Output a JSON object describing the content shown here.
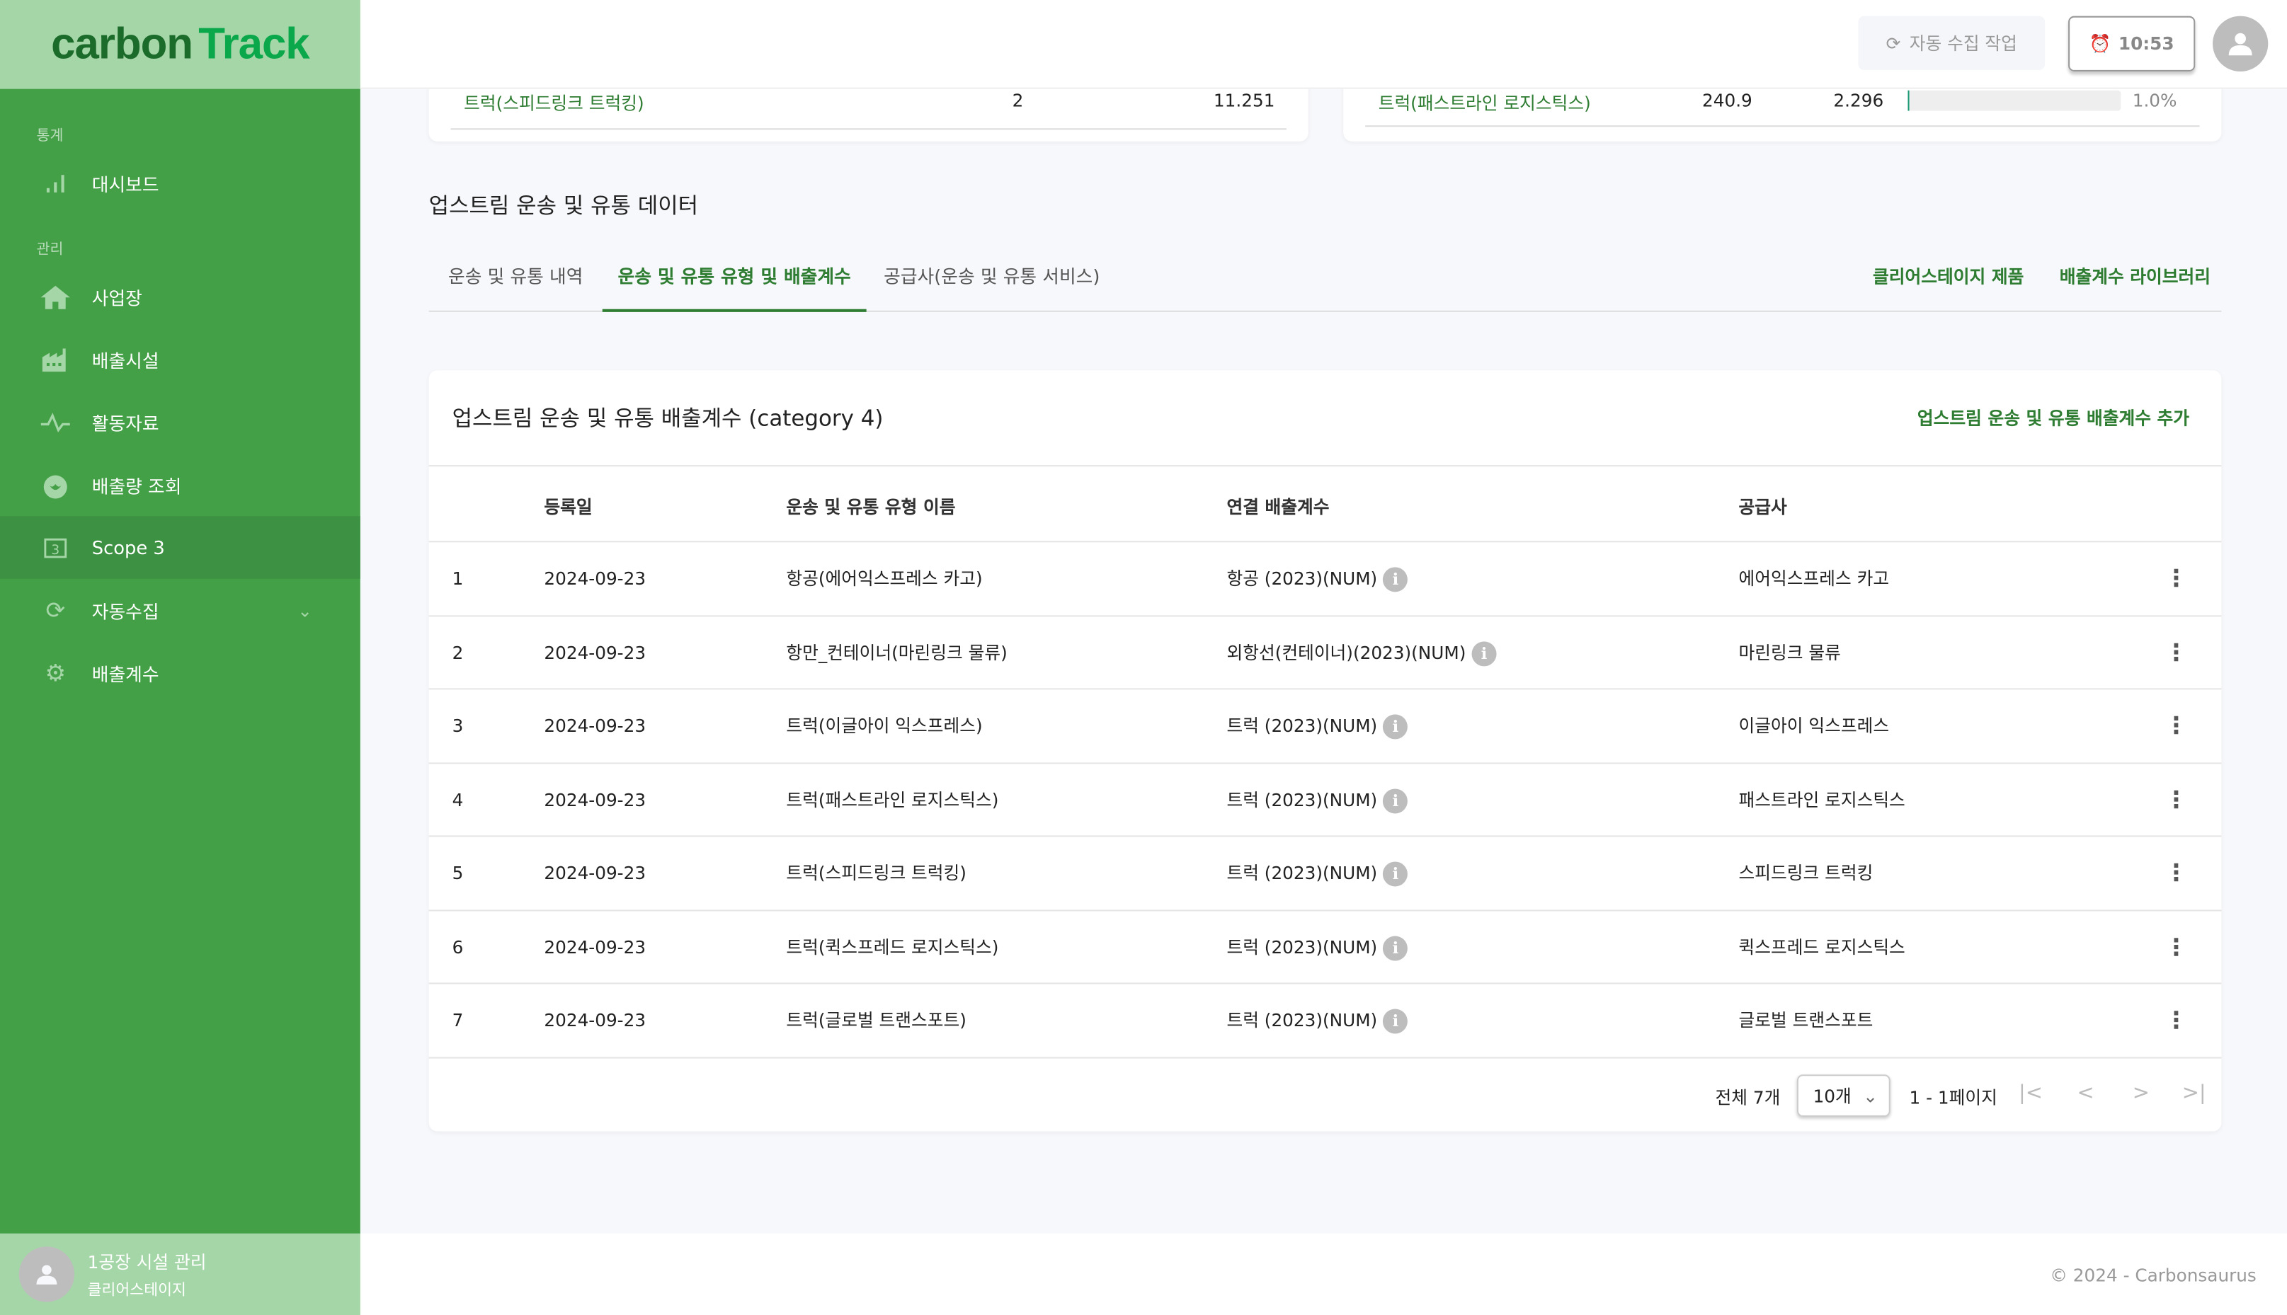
{
  "brand": {
    "part1": "carbon",
    "part2": "Track"
  },
  "sidebar": {
    "sections": [
      {
        "label": "통계"
      },
      {
        "label": "관리"
      }
    ],
    "items": [
      {
        "label": "대시보드",
        "icon": "bar-chart-icon"
      },
      {
        "label": "사업장",
        "icon": "home-icon"
      },
      {
        "label": "배출시설",
        "icon": "factory-icon"
      },
      {
        "label": "활동자료",
        "icon": "activity-icon"
      },
      {
        "label": "배출량 조회",
        "icon": "fire-icon"
      },
      {
        "label": "Scope 3",
        "icon": "scope3-icon",
        "active": true
      },
      {
        "label": "자동수집",
        "icon": "sync-icon",
        "expandable": true
      },
      {
        "label": "배출계수",
        "icon": "gear-icon"
      }
    ],
    "user": {
      "name": "1공장 시설 관리",
      "org": "클리어스테이지"
    }
  },
  "topbar": {
    "auto_collect_label": "자동 수집 작업",
    "time": "10:53"
  },
  "prev_cards": {
    "left": {
      "name": "트럭(스피드링크 트럭킹)",
      "count": "2",
      "value": "11.251"
    },
    "right": {
      "name": "트럭(패스트라인 로지스틱스)",
      "v1": "240.9",
      "v2": "2.296",
      "percent_label": "1.0%",
      "percent": 1.0
    }
  },
  "section_title": "업스트림 운송 및 유통 데이터",
  "tabs": [
    {
      "label": "운송 및 유통 내역"
    },
    {
      "label": "운송 및 유통 유형 및 배출계수",
      "active": true
    },
    {
      "label": "공급사(운송 및 유통 서비스)"
    }
  ],
  "links": {
    "clearstage_products": "클리어스테이지 제품",
    "factor_library": "배출계수 라이브러리"
  },
  "table_card": {
    "title": "업스트림 운송 및 유통 배출계수 (category 4)",
    "add_label": "업스트림 운송 및 유통 배출계수 추가",
    "columns": [
      "등록일",
      "운송 및 유통 유형 이름",
      "연결 배출계수",
      "공급사"
    ],
    "rows": [
      {
        "no": "1",
        "date": "2024-09-23",
        "name": "항공(에어익스프레스 카고)",
        "factor": "항공 (2023)(NUM)",
        "supplier": "에어익스프레스 카고"
      },
      {
        "no": "2",
        "date": "2024-09-23",
        "name": "항만_컨테이너(마린링크 물류)",
        "factor": "외항선(컨테이너)(2023)(NUM)",
        "supplier": "마린링크 물류"
      },
      {
        "no": "3",
        "date": "2024-09-23",
        "name": "트럭(이글아이 익스프레스)",
        "factor": "트럭 (2023)(NUM)",
        "supplier": "이글아이 익스프레스"
      },
      {
        "no": "4",
        "date": "2024-09-23",
        "name": "트럭(패스트라인 로지스틱스)",
        "factor": "트럭 (2023)(NUM)",
        "supplier": "패스트라인 로지스틱스"
      },
      {
        "no": "5",
        "date": "2024-09-23",
        "name": "트럭(스피드링크 트럭킹)",
        "factor": "트럭 (2023)(NUM)",
        "supplier": "스피드링크 트럭킹"
      },
      {
        "no": "6",
        "date": "2024-09-23",
        "name": "트럭(퀵스프레드 로지스틱스)",
        "factor": "트럭 (2023)(NUM)",
        "supplier": "퀵스프레드 로지스틱스"
      },
      {
        "no": "7",
        "date": "2024-09-23",
        "name": "트럭(글로벌 트랜스포트)",
        "factor": "트럭 (2023)(NUM)",
        "supplier": "글로벌 트랜스포트"
      }
    ],
    "pagination": {
      "total": "전체 7개",
      "page_size": "10개",
      "range": "1 - 1페이지"
    }
  },
  "footer": "© 2024 - Carbonsaurus",
  "colors": {
    "sidebar": "#43a047",
    "logo_bg": "#a5d6a7",
    "accent": "#2e7d32"
  }
}
